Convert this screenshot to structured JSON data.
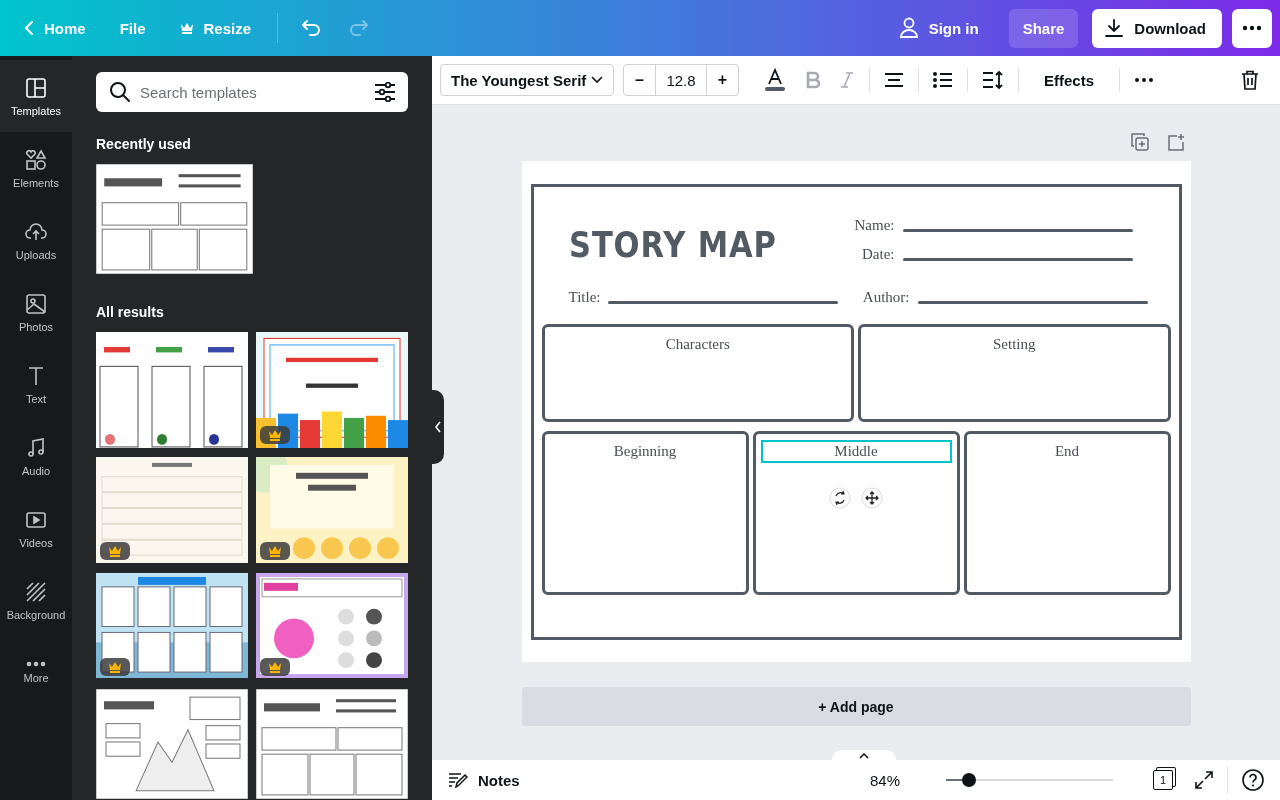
{
  "topbar": {
    "home": "Home",
    "file": "File",
    "resize": "Resize",
    "undo": {
      "disabled": false
    },
    "redo": {
      "disabled": true
    },
    "sign_in": "Sign in",
    "share": "Share",
    "download": "Download"
  },
  "rail": [
    {
      "label": "Templates",
      "selected": true
    },
    {
      "label": "Elements",
      "selected": false
    },
    {
      "label": "Uploads",
      "selected": false
    },
    {
      "label": "Photos",
      "selected": false
    },
    {
      "label": "Text",
      "selected": false
    },
    {
      "label": "Audio",
      "selected": false
    },
    {
      "label": "Videos",
      "selected": false
    },
    {
      "label": "Background",
      "selected": false
    },
    {
      "label": "More",
      "selected": false
    }
  ],
  "panel": {
    "search": {
      "placeholder": "Search templates"
    },
    "recently_used": {
      "title": "Recently used",
      "templates": [
        {
          "kind": "picture",
          "premium": false
        }
      ]
    },
    "all_results": {
      "title": "All results",
      "templates": [
        {
          "kind": "picture",
          "premium": false
        },
        {
          "kind": "picture",
          "premium": true
        },
        {
          "kind": "picture",
          "premium": true
        },
        {
          "kind": "picture",
          "premium": true
        },
        {
          "kind": "picture",
          "premium": true
        },
        {
          "kind": "picture",
          "premium": true
        },
        {
          "kind": "picture",
          "premium": false
        },
        {
          "kind": "picture",
          "premium": false
        }
      ]
    }
  },
  "toolbar": {
    "font": "The Youngest Serif",
    "minus": "–",
    "size": "12.8",
    "plus": "+",
    "bold": {
      "disabled": true
    },
    "italic": {
      "disabled": true
    },
    "effects": "Effects"
  },
  "document": {
    "title": "STORY MAP",
    "fields": [
      {
        "label": "Name:"
      },
      {
        "label": "Date:"
      },
      {
        "label": "Title:"
      },
      {
        "label": "Author:"
      }
    ],
    "boxes": [
      {
        "label": "Characters",
        "selected": false
      },
      {
        "label": "Setting",
        "selected": false
      },
      {
        "label": "Beginning",
        "selected": false
      },
      {
        "label": "Middle",
        "selected": true
      },
      {
        "label": "End",
        "selected": false
      }
    ]
  },
  "add_page": "+ Add page",
  "footer": {
    "notes": "Notes",
    "zoom": "84%",
    "zoom_slider": {
      "level": 0.14
    },
    "page_count": "1"
  }
}
